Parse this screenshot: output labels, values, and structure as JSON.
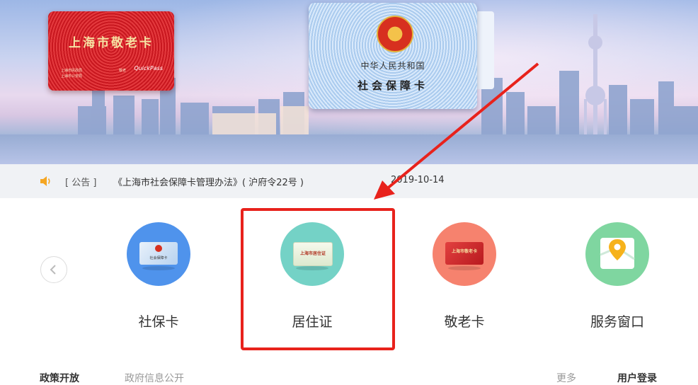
{
  "banner": {
    "elder_card": {
      "title": "上海市敬老卡",
      "issuer_line1": "上海市民政局",
      "issuer_line2": "上海市公安局",
      "mark": "敬老",
      "brand": "QuickPass"
    },
    "social_card": {
      "country": "中华人民共和国",
      "title": "社会保障卡"
    }
  },
  "notice": {
    "icon": "speaker-icon",
    "tag": "[ 公告 ]",
    "title": "《上海市社会保障卡管理办法》( 沪府令22号 )",
    "date": "2019-10-14"
  },
  "services": [
    {
      "label": "社保卡",
      "circle_color": "#4f93ec",
      "card_text": "社会保障卡"
    },
    {
      "label": "居住证",
      "circle_color": "#74d2c6",
      "card_text": "上海市居住证"
    },
    {
      "label": "敬老卡",
      "circle_color": "#f6826e",
      "card_text": "上海市敬老卡"
    },
    {
      "label": "服务窗口",
      "circle_color": "#7fd6a0",
      "card_text": ""
    }
  ],
  "carousel": {
    "prev_icon": "chevron-left-icon"
  },
  "annotation": {
    "color": "#e8221c",
    "highlighted": "居住证"
  },
  "bottom_tabs": [
    "政策开放",
    "政府信息公开",
    "更多",
    "用户登录"
  ]
}
